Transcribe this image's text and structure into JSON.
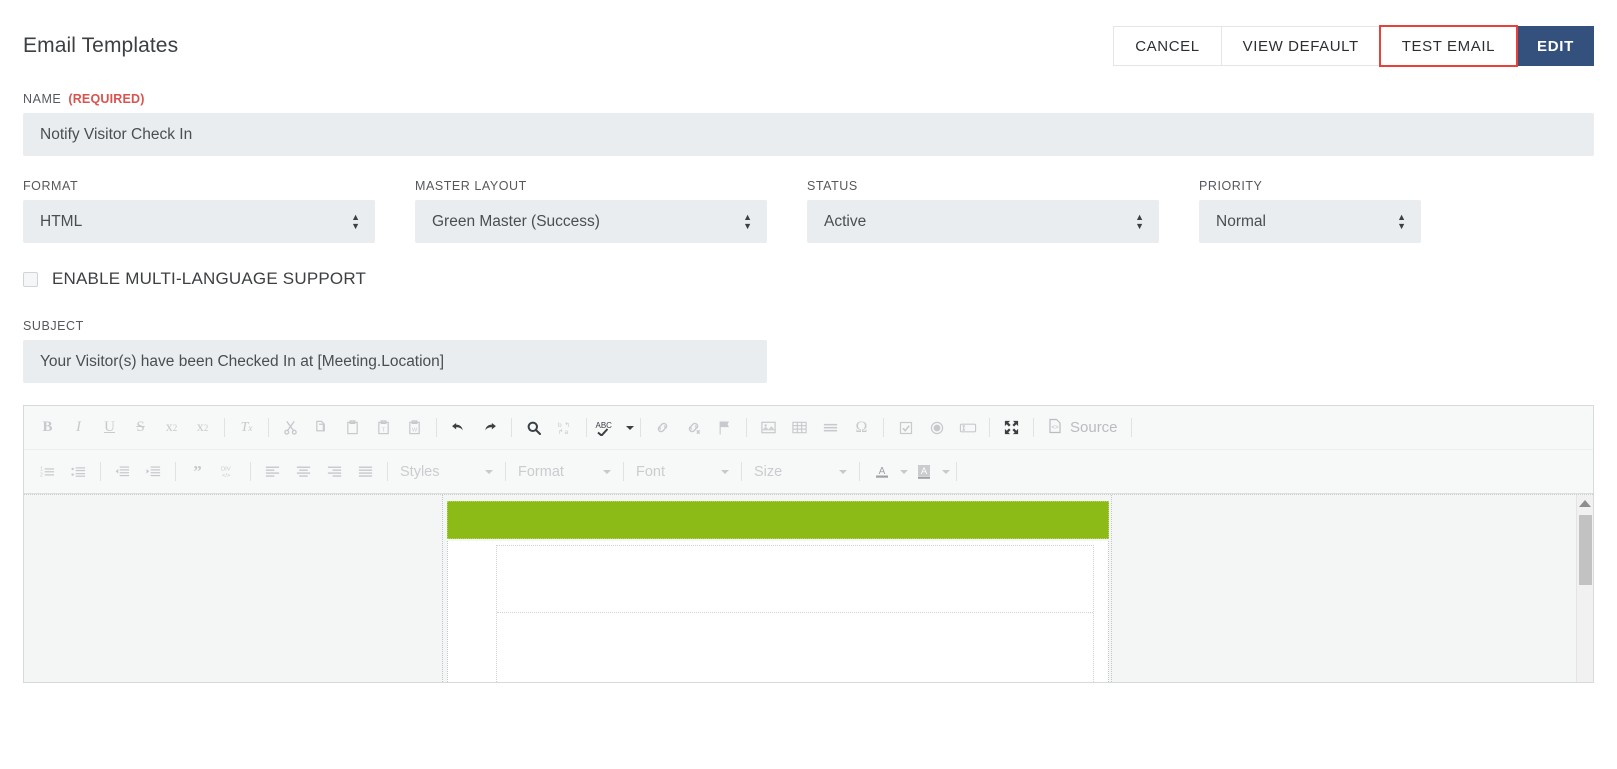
{
  "header": {
    "title": "Email Templates",
    "buttons": [
      {
        "label": "CANCEL",
        "name": "cancel-button",
        "style": "default"
      },
      {
        "label": "VIEW DEFAULT",
        "name": "view-default-button",
        "style": "default"
      },
      {
        "label": "TEST EMAIL",
        "name": "test-email-button",
        "style": "highlight"
      },
      {
        "label": "EDIT",
        "name": "edit-button",
        "style": "primary"
      }
    ],
    "highlight_color": "#e8413c",
    "primary_color": "#34507c"
  },
  "form": {
    "name_field": {
      "label": "NAME",
      "required_note": "(Required)",
      "value": "Notify Visitor Check In"
    },
    "selects": [
      {
        "label": "FORMAT",
        "value": "HTML",
        "name": "format-select"
      },
      {
        "label": "MASTER LAYOUT",
        "value": "Green Master (Success)",
        "name": "master-layout-select"
      },
      {
        "label": "STATUS",
        "value": "Active",
        "name": "status-select"
      },
      {
        "label": "PRIORITY",
        "value": "Normal",
        "name": "priority-select"
      }
    ],
    "multilang": {
      "label": "ENABLE MULTI-LANGUAGE SUPPORT",
      "checked": false
    },
    "subject_field": {
      "label": "SUBJECT",
      "value": "Your Visitor(s) have been Checked In at [Meeting.Location]"
    }
  },
  "editor": {
    "source_label": "Source",
    "toolbar_row1": [
      {
        "icon": "bold-icon",
        "label": "B"
      },
      {
        "icon": "italic-icon",
        "label": "I"
      },
      {
        "icon": "underline-icon",
        "label": "U"
      },
      {
        "icon": "strikethrough-icon",
        "label": "S"
      },
      {
        "icon": "subscript-icon",
        "label": "x₂"
      },
      {
        "icon": "superscript-icon",
        "label": "x²"
      },
      {
        "icon": "separator"
      },
      {
        "icon": "remove-format-icon",
        "label": "Tx"
      },
      {
        "icon": "separator"
      },
      {
        "icon": "cut-icon",
        "label": "Cut"
      },
      {
        "icon": "copy-icon",
        "label": "Copy"
      },
      {
        "icon": "paste-icon",
        "label": "Paste"
      },
      {
        "icon": "paste-text-icon",
        "label": "Paste as plain text"
      },
      {
        "icon": "paste-word-icon",
        "label": "Paste from Word"
      },
      {
        "icon": "separator"
      },
      {
        "icon": "undo-icon",
        "label": "Undo"
      },
      {
        "icon": "redo-icon",
        "label": "Redo"
      },
      {
        "icon": "separator"
      },
      {
        "icon": "find-icon",
        "label": "Find"
      },
      {
        "icon": "replace-icon",
        "label": "Replace"
      },
      {
        "icon": "separator"
      },
      {
        "icon": "spellcheck-icon",
        "label": "ABC"
      },
      {
        "icon": "separator"
      },
      {
        "icon": "link-icon",
        "label": "Link"
      },
      {
        "icon": "unlink-icon",
        "label": "Unlink"
      },
      {
        "icon": "anchor-icon",
        "label": "Anchor"
      },
      {
        "icon": "separator"
      },
      {
        "icon": "image-icon",
        "label": "Image"
      },
      {
        "icon": "table-icon",
        "label": "Table"
      },
      {
        "icon": "horizontal-rule-icon",
        "label": "Horizontal Line"
      },
      {
        "icon": "special-char-icon",
        "label": "Ω"
      },
      {
        "icon": "separator"
      },
      {
        "icon": "checkbox-field-icon",
        "label": "Checkbox"
      },
      {
        "icon": "radio-field-icon",
        "label": "Radio Button"
      },
      {
        "icon": "text-field-icon",
        "label": "Text Field"
      },
      {
        "icon": "separator"
      },
      {
        "icon": "maximize-icon",
        "label": "Maximize"
      },
      {
        "icon": "separator"
      },
      {
        "icon": "source-icon",
        "label": "Source"
      }
    ],
    "toolbar_row2": [
      {
        "icon": "numbered-list-icon",
        "label": "Insert/Remove Numbered List"
      },
      {
        "icon": "bulleted-list-icon",
        "label": "Insert/Remove Bulleted List"
      },
      {
        "icon": "separator"
      },
      {
        "icon": "outdent-icon",
        "label": "Decrease Indent"
      },
      {
        "icon": "indent-icon",
        "label": "Increase Indent"
      },
      {
        "icon": "separator"
      },
      {
        "icon": "blockquote-icon",
        "label": "Block Quote"
      },
      {
        "icon": "div-icon",
        "label": "DIV"
      },
      {
        "icon": "separator"
      },
      {
        "icon": "align-left-icon",
        "label": "Align Left"
      },
      {
        "icon": "align-center-icon",
        "label": "Center"
      },
      {
        "icon": "align-right-icon",
        "label": "Align Right"
      },
      {
        "icon": "align-justify-icon",
        "label": "Justify"
      },
      {
        "icon": "separator"
      }
    ],
    "combos": [
      {
        "label": "Styles",
        "name": "styles-combo"
      },
      {
        "label": "Format",
        "name": "format-combo"
      },
      {
        "label": "Font",
        "name": "font-combo"
      },
      {
        "label": "Size",
        "name": "size-combo"
      }
    ],
    "color_buttons": [
      {
        "icon": "text-color-icon",
        "label": "A"
      },
      {
        "icon": "background-color-icon",
        "label": "A"
      }
    ],
    "content": {
      "banner_color": "#8cbb18"
    }
  }
}
